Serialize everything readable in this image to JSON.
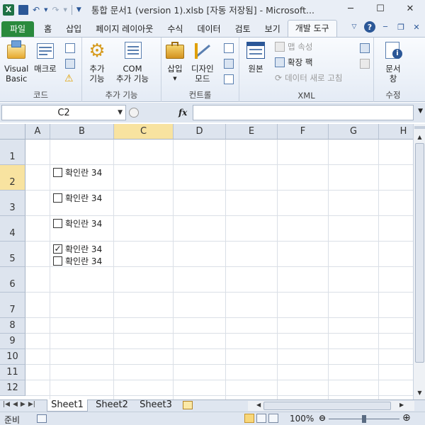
{
  "titlebar": {
    "qat_undo": "↶",
    "qat_redo": "↷",
    "title": "통합 문서1 (version 1).xlsb [자동 저장됨]  -  Microsoft...",
    "minimize": "─",
    "maximize": "☐",
    "close": "✕"
  },
  "tabs": [
    "홈",
    "삽입",
    "페이지 레이아웃",
    "수식",
    "데이터",
    "검토",
    "보기"
  ],
  "file_tab": "파일",
  "active_tab": "개발 도구",
  "ribbon": {
    "code": {
      "label": "코드",
      "visual_basic": "Visual\nBasic",
      "macro": "매크로"
    },
    "addins": {
      "label": "추가 기능",
      "addins_btn": "추가\n기능",
      "com_addins": "COM\n추가 기능"
    },
    "controls": {
      "label": "컨트롤",
      "insert": "삽입",
      "design_mode": "디자인\n모드"
    },
    "xml": {
      "label": "XML",
      "source": "원본",
      "map_properties": "맵 속성",
      "expansion_packs": "확장 팩",
      "refresh_data": "데이터 새로 고침"
    },
    "modify": {
      "label": "수정",
      "document_panel": "문서\n창"
    }
  },
  "formula_bar": {
    "name_box": "C2",
    "fx": "fx",
    "formula": ""
  },
  "grid": {
    "columns": [
      "A",
      "B",
      "C",
      "D",
      "E",
      "F",
      "G",
      "H"
    ],
    "rows": [
      "1",
      "2",
      "3",
      "4",
      "5",
      "6",
      "7",
      "8",
      "9",
      "10",
      "11",
      "12"
    ],
    "selected_cell": "C2",
    "checkboxes": [
      {
        "label": "확인란 34",
        "checked": false
      },
      {
        "label": "확인란 34",
        "checked": false
      },
      {
        "label": "확인란 34",
        "checked": false
      },
      {
        "label": "확인란 34",
        "checked": true
      },
      {
        "label": "확인란 34",
        "checked": false
      }
    ]
  },
  "sheets": [
    "Sheet1",
    "Sheet2",
    "Sheet3"
  ],
  "active_sheet": "Sheet1",
  "status": {
    "ready": "준비",
    "zoom": "100%"
  },
  "colors": {
    "file_tab": "#2a8a3d",
    "header_bg": "#dde4ee",
    "header_selected": "#f8e3a0"
  }
}
